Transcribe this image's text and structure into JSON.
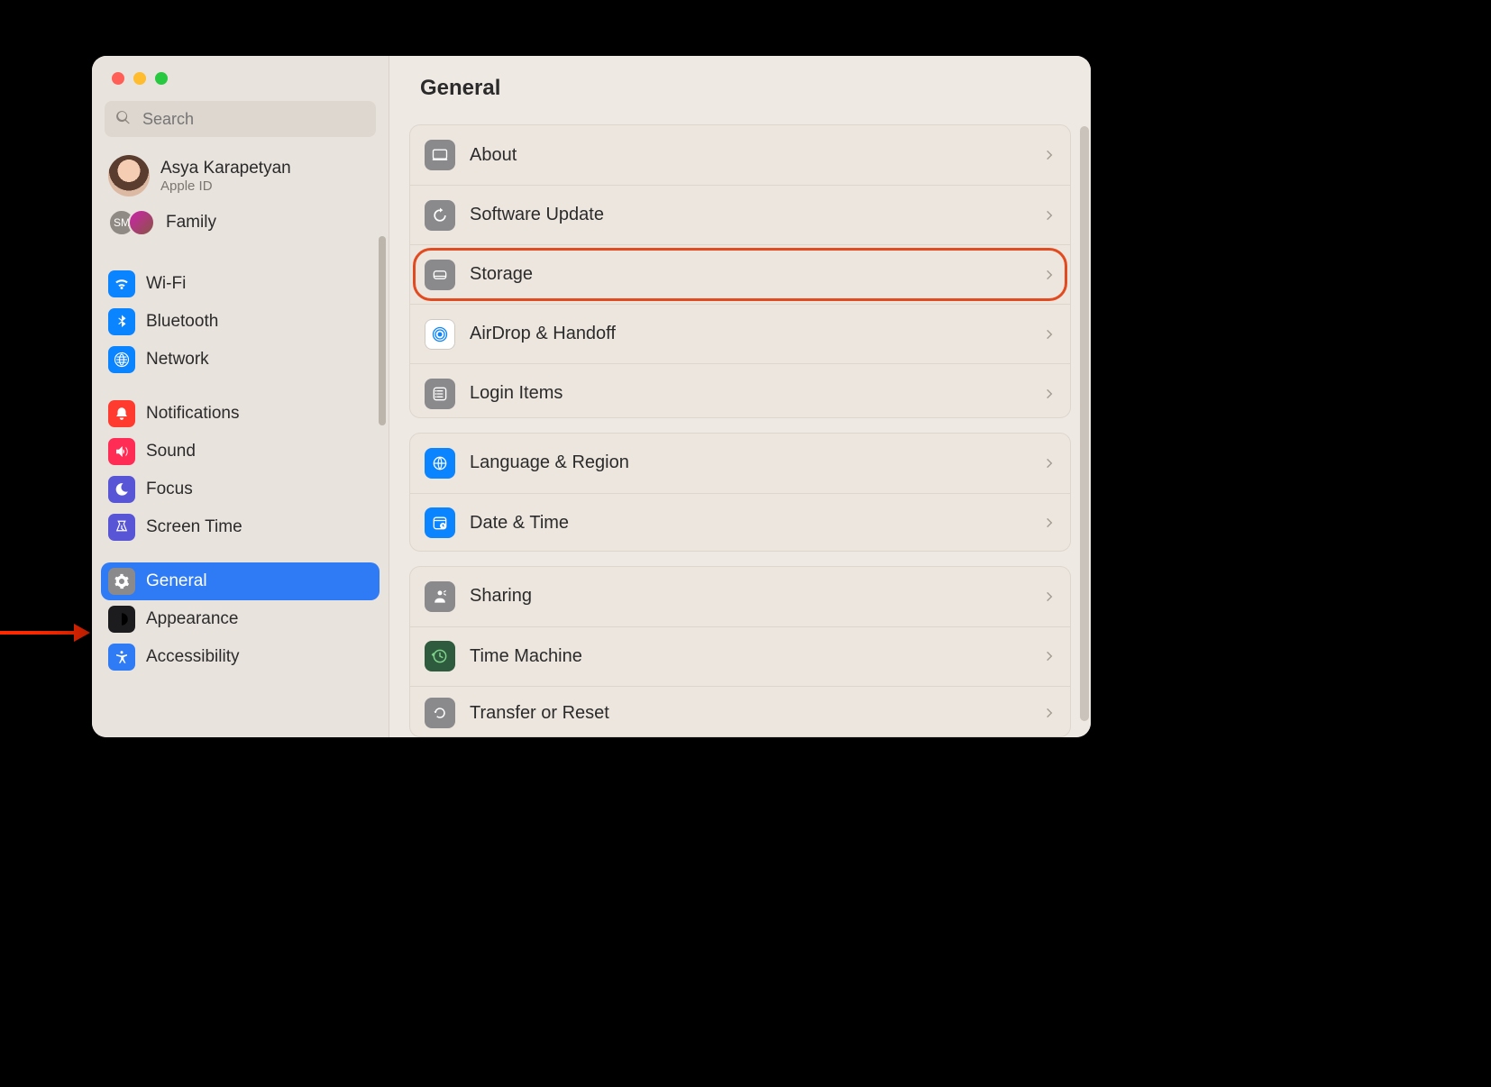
{
  "search": {
    "placeholder": "Search"
  },
  "account": {
    "name": "Asya Karapetyan",
    "sub": "Apple ID"
  },
  "family": {
    "label": "Family",
    "badge_initials": "SM"
  },
  "sidebar": {
    "wifi": "Wi-Fi",
    "bluetooth": "Bluetooth",
    "network": "Network",
    "notifications": "Notifications",
    "sound": "Sound",
    "focus": "Focus",
    "screentime": "Screen Time",
    "general": "General",
    "appearance": "Appearance",
    "accessibility": "Accessibility"
  },
  "header": {
    "title": "General"
  },
  "general": {
    "about": "About",
    "software_update": "Software Update",
    "storage": "Storage",
    "airdrop": "AirDrop & Handoff",
    "login_items": "Login Items",
    "language_region": "Language & Region",
    "date_time": "Date & Time",
    "sharing": "Sharing",
    "time_machine": "Time Machine",
    "transfer_reset": "Transfer or Reset"
  },
  "annotation": {
    "highlighted_row": "storage",
    "arrow_points_to": "general"
  }
}
